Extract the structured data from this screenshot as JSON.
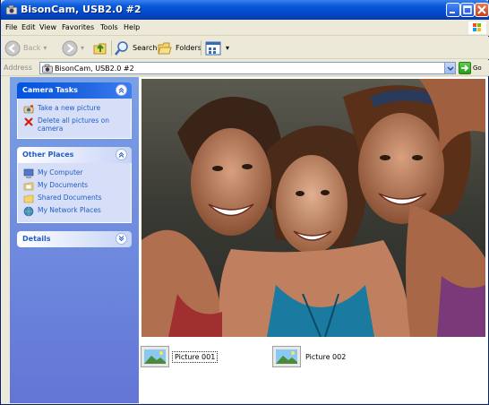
{
  "window": {
    "title": "BisonCam, USB2.0 #2"
  },
  "menu": [
    "File",
    "Edit",
    "View",
    "Favorites",
    "Tools",
    "Help"
  ],
  "toolbar": {
    "back": "Back",
    "search": "Search",
    "folders": "Folders"
  },
  "address": {
    "label": "Address",
    "value": "BisonCam, USB2.0 #2",
    "go": "Go"
  },
  "camera_tasks": {
    "title": "Camera Tasks",
    "items": [
      "Take a new picture",
      "Delete all pictures on camera"
    ]
  },
  "other_places": {
    "title": "Other Places",
    "items": [
      "My Computer",
      "My Documents",
      "Shared Documents",
      "My Network Places"
    ]
  },
  "details": {
    "title": "Details"
  },
  "pictures": [
    "Picture 001",
    "Picture 002"
  ],
  "colors": {
    "title_bar": "#0a5ad8",
    "task_pane": "#6e8ee0",
    "link": "#215dc6"
  }
}
